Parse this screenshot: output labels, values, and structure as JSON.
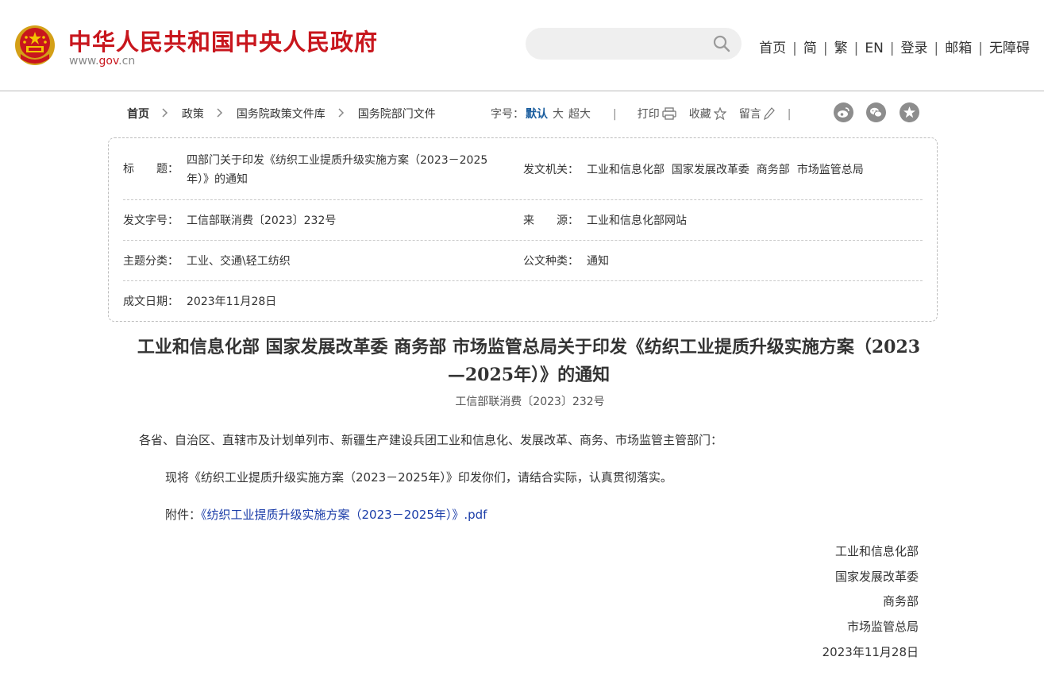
{
  "header": {
    "site_title": "中华人民共和国中央人民政府",
    "site_domain_prefix": "www.",
    "site_domain_main": "gov",
    "site_domain_suffix": ".cn",
    "search": {
      "placeholder": "",
      "value": ""
    },
    "nav": [
      "首页",
      "简",
      "繁",
      "EN",
      "登录",
      "邮箱",
      "无障碍"
    ],
    "nav_separator": "|",
    "brand_color": "#c8161d"
  },
  "breadcrumb": [
    "首页",
    "政策",
    "国务院政策文件库",
    "国务院部门文件"
  ],
  "tools": {
    "font_size_label": "字号：",
    "font_sizes": [
      "默认",
      "大",
      "超大"
    ],
    "divider": "|",
    "print": "打印",
    "favorite": "收藏",
    "comment": "留言",
    "share_icons": [
      "weibo-icon",
      "wechat-icon",
      "star-circle-icon"
    ]
  },
  "info": {
    "title_label": "标　　题：",
    "title_value": "四部门关于印发《纺织工业提质升级实施方案（2023－2025年）》的通知",
    "issuer_label": "发文机关：",
    "issuer_value": "工业和信息化部  国家发展改革委  商务部  市场监管总局",
    "doc_no_label": "发文字号：",
    "doc_no_value": "工信部联消费〔2023〕232号",
    "source_label": "来　　源：",
    "source_value": "工业和信息化部网站",
    "category_label": "主题分类：",
    "category_value": "工业、交通\\轻工纺织",
    "doc_type_label": "公文种类：",
    "doc_type_value": "通知",
    "date_label": "成文日期：",
    "date_value": "2023年11月28日"
  },
  "article": {
    "title": "工业和信息化部 国家发展改革委 商务部 市场监管总局关于印发《纺织工业提质升级实施方案（2023—2025年）》的通知",
    "doc_number": "工信部联消费〔2023〕232号",
    "salutation": "各省、自治区、直辖市及计划单列市、新疆生产建设兵团工业和信息化、发展改革、商务、市场监管主管部门：",
    "body": "现将《纺织工业提质升级实施方案（2023－2025年）》印发你们，请结合实际，认真贯彻落实。",
    "attachment_label": "附件：",
    "attachment_link": "《纺织工业提质升级实施方案（2023－2025年）》.pdf",
    "signatures": [
      "工业和信息化部",
      "国家发展改革委",
      "商务部",
      "市场监管总局"
    ],
    "sign_date": "2023年11月28日"
  }
}
